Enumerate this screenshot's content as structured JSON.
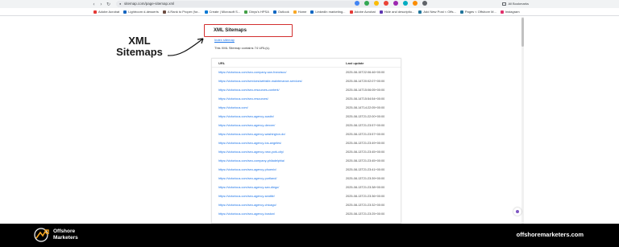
{
  "browser": {
    "url": "sitemap.com/page-sitemap.xml",
    "bookmarks": [
      {
        "label": "Adobe Acrobat",
        "color": "#e53935"
      },
      {
        "label": "Lightroom d-desserts",
        "color": "#1565c0"
      },
      {
        "label": "A Rank to Proper (for...",
        "color": "#6d4c41"
      },
      {
        "label": "Create | Microsoft S...",
        "color": "#0078d4"
      },
      {
        "label": "Dinys's HPSA",
        "color": "#43a047"
      },
      {
        "label": "Outlook",
        "color": "#0a66c2"
      },
      {
        "label": "Home",
        "color": "#f9a825"
      },
      {
        "label": "LinkedIn marketing...",
        "color": "#0a66c2"
      },
      {
        "label": "Adobe Acrobat",
        "color": "#e53935"
      },
      {
        "label": "Hide and descriptio...",
        "color": "#5e35b1"
      },
      {
        "label": "Add New Post < Offs...",
        "color": "#21759b"
      },
      {
        "label": "Pages < Offshore M...",
        "color": "#21759b"
      },
      {
        "label": "Instagram",
        "color": "#e1306c"
      }
    ],
    "all_bookmarks": "All Bookmarks"
  },
  "callout": {
    "line1": "XML",
    "line2": "Sitemaps"
  },
  "sitemap": {
    "title": "XML Sitemaps",
    "index_link": "Index sitemap",
    "summary": "This XML Sitemap contains 74 URL(s).",
    "columns": {
      "url": "URL",
      "last_update": "Last update"
    },
    "rows": [
      {
        "url": "https://victorious.com/seo-company-san-francisco/",
        "date": "2025-08-15T22:06:46+00:00"
      },
      {
        "url": "https://victorious.com/services/website-maintenance-services/",
        "date": "2025-08-14T20:02:07+00:00"
      },
      {
        "url": "https://victorious.com/seo-resources-content/",
        "date": "2025-08-14T15:06:05+00:00"
      },
      {
        "url": "https://victorious.com/seo-resources/",
        "date": "2025-08-14T15:54:54+00:00"
      },
      {
        "url": "https://victorious.com/",
        "date": "2025-08-14T14:22:05+00:00"
      },
      {
        "url": "https://victorious.com/seo-agency-austin/",
        "date": "2025-08-13T21:22:00+00:00"
      },
      {
        "url": "https://victorious.com/seo-agency-denver/",
        "date": "2025-08-13T21:23:57+00:00"
      },
      {
        "url": "https://victorious.com/seo-agency-washington-dc/",
        "date": "2025-08-13T21:23:57+00:00"
      },
      {
        "url": "https://victorious.com/seo-agency-los-angeles/",
        "date": "2025-08-13T21:23:49+00:00"
      },
      {
        "url": "https://victorious.com/seo-agency-new-york-city/",
        "date": "2025-08-13T21:23:45+00:00"
      },
      {
        "url": "https://victorious.com/seo-company-philadelphia/",
        "date": "2025-08-13T21:23:45+00:00"
      },
      {
        "url": "https://victorious.com/seo-agency-phoenix/",
        "date": "2025-08-13T21:23:41+00:00"
      },
      {
        "url": "https://victorious.com/seo-agency-portland/",
        "date": "2025-08-13T21:23:39+00:00"
      },
      {
        "url": "https://victorious.com/seo-agency-san-diego/",
        "date": "2025-08-13T21:23:38+00:00"
      },
      {
        "url": "https://victorious.com/seo-agency-seattle/",
        "date": "2025-08-13T21:23:36+00:00"
      },
      {
        "url": "https://victorious.com/seo-agency-chicago/",
        "date": "2025-08-13T21:23:32+00:00"
      },
      {
        "url": "https://victorious.com/seo-agency-boston/",
        "date": "2025-08-13T21:23:25+00:00"
      }
    ]
  },
  "footer": {
    "brand_line1": "Offshore",
    "brand_line2": "Marketers",
    "site": "offshoremarketers.com"
  },
  "colors": {
    "highlight_border": "#d32f2f",
    "link": "#1a73e8",
    "footer_bg": "#000000",
    "logo_orange": "#f5a623"
  }
}
